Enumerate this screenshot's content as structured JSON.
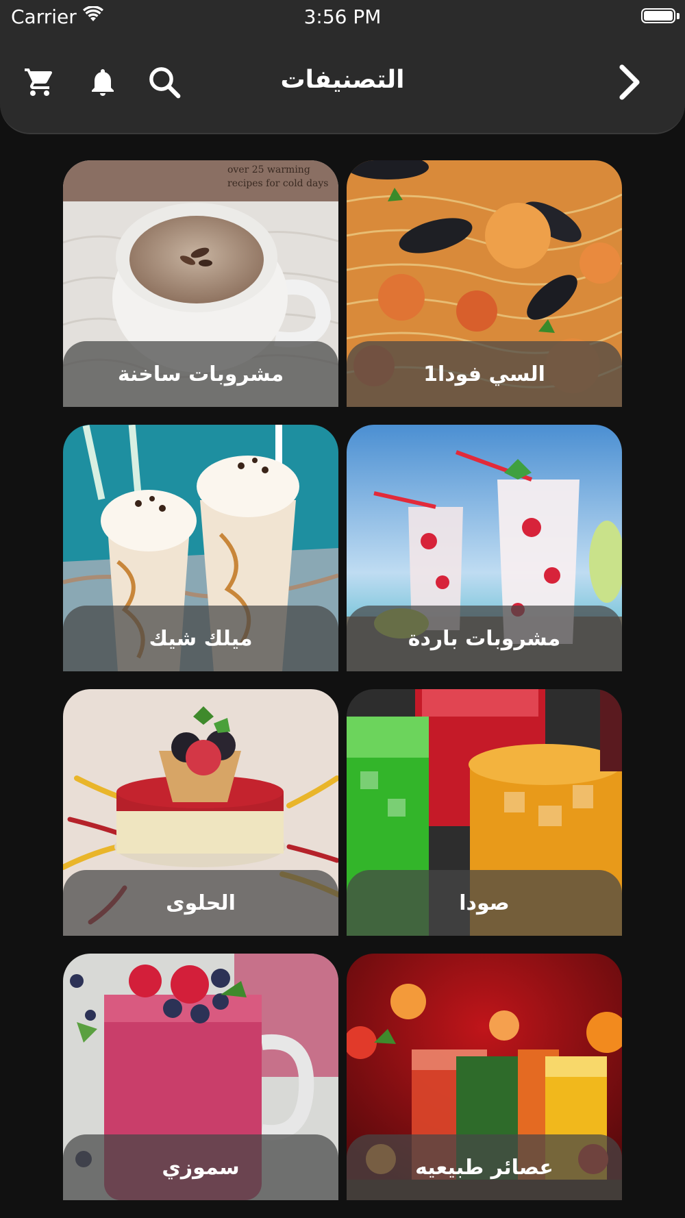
{
  "status_bar": {
    "carrier": "Carrier",
    "time": "3:56 PM"
  },
  "nav": {
    "title": "التصنيفات",
    "icons": [
      "cart-icon",
      "bell-icon",
      "search-icon",
      "chevron-right-icon"
    ]
  },
  "categories": [
    {
      "label": "مشروبات ساخنة",
      "image": "hot-drink-photo",
      "image_text": [
        "over 25 warming",
        "recipes for cold days"
      ]
    },
    {
      "label": "السي فودا1",
      "image": "seafood-pasta-photo"
    },
    {
      "label": "ميلك شيك",
      "image": "milkshake-photo"
    },
    {
      "label": "مشروبات باردة",
      "image": "cold-drinks-photo"
    },
    {
      "label": "الحلوى",
      "image": "dessert-photo"
    },
    {
      "label": "صودا",
      "image": "soda-photo"
    },
    {
      "label": "سموزي",
      "image": "smoothie-photo"
    },
    {
      "label": "عصائر طبيعيه",
      "image": "natural-juices-photo"
    }
  ],
  "colors": {
    "background": "#111111",
    "navbar": "#2b2b2b",
    "label_overlay": "#464646",
    "text": "#ffffff"
  }
}
